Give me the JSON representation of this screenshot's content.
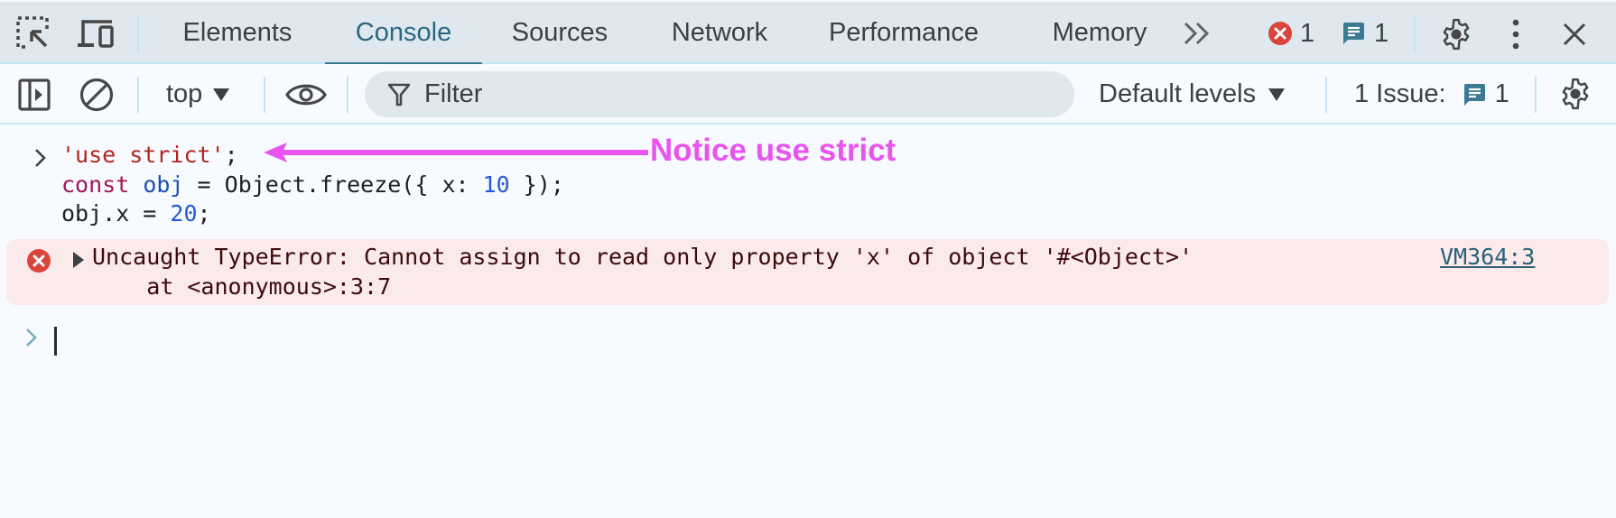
{
  "tabbar": {
    "tabs": [
      {
        "label": "Elements"
      },
      {
        "label": "Console",
        "active": true
      },
      {
        "label": "Sources"
      },
      {
        "label": "Network"
      },
      {
        "label": "Performance"
      },
      {
        "label": "Memory"
      }
    ],
    "more_tabs_icon": "chevron-double-right-icon",
    "error_count": "1",
    "message_count": "1"
  },
  "toolbar": {
    "context": "top",
    "filter_placeholder": "Filter",
    "levels": "Default levels",
    "issues_label": "1 Issue:",
    "issues_count": "1"
  },
  "console": {
    "input": {
      "line1_str": "'use strict'",
      "line1_end": ";",
      "line2_kw": "const",
      "line2_var": "obj",
      "line2_mid": " = Object.freeze({ x: ",
      "line2_num": "10",
      "line2_end": " });",
      "line3_start": "obj.x = ",
      "line3_num": "20",
      "line3_end": ";"
    },
    "error": {
      "message": "Uncaught TypeError: Cannot assign to read only property 'x' of object '#<Object>'",
      "stack": "    at <anonymous>:3:7",
      "source_link": "VM364:3"
    }
  },
  "annotation": {
    "text": "Notice use strict",
    "color": "#e954f0"
  },
  "colors": {
    "accent": "#3a7a93",
    "error": "#d9453c",
    "error_bg": "#fbeaea",
    "message_badge": "#3a7a93"
  }
}
